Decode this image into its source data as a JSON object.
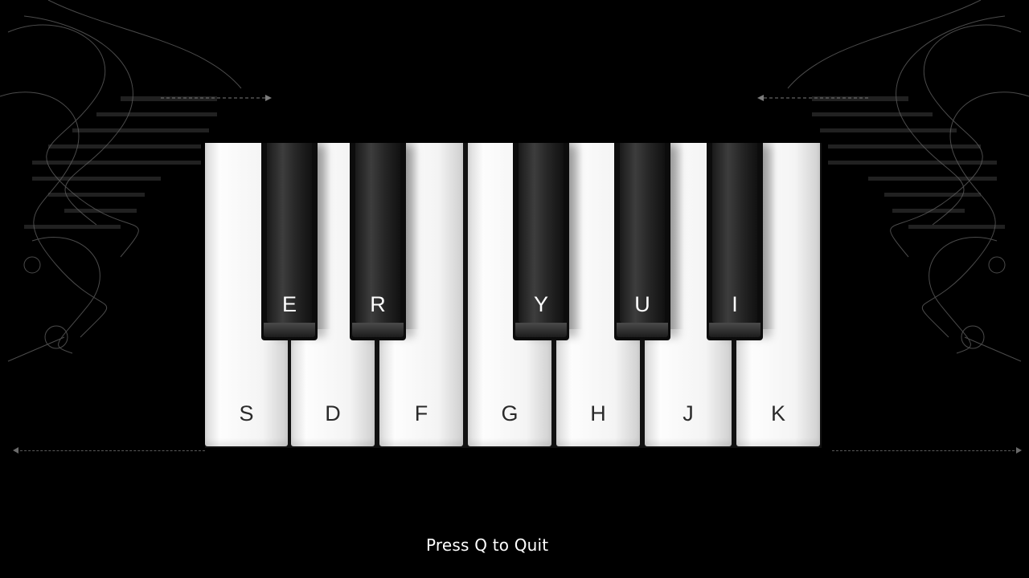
{
  "keyboard": {
    "white_keys": [
      {
        "label": "S"
      },
      {
        "label": "D"
      },
      {
        "label": "F"
      },
      {
        "label": "G"
      },
      {
        "label": "H"
      },
      {
        "label": "J"
      },
      {
        "label": "K"
      }
    ],
    "black_keys": [
      {
        "label": "E"
      },
      {
        "label": "R"
      },
      {
        "label": "Y"
      },
      {
        "label": "U"
      },
      {
        "label": "I"
      }
    ]
  },
  "footer": {
    "quit_hint": "Press Q to Quit"
  },
  "colors": {
    "background": "#000000",
    "white_key": "#f4f4f4",
    "black_key": "#0c0c0c",
    "hint_text": "#ffffff"
  }
}
